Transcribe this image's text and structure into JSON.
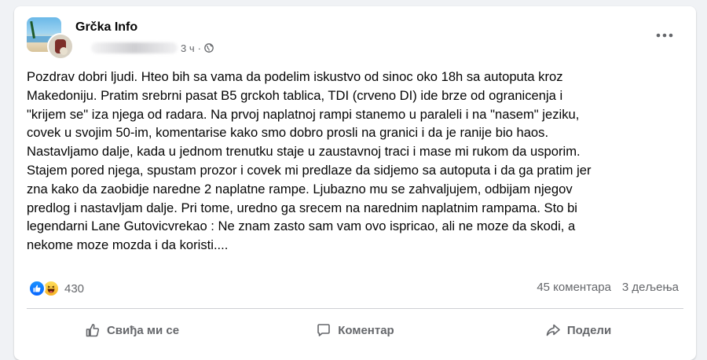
{
  "post": {
    "page_name": "Grčka Info",
    "time_label": "3 ч",
    "text": "Pozdrav dobri ljudi. Hteo bih sa vama da podelim iskustvo od sinoc oko 18h sa autoputa kroz\nMakedoniju. Pratim srebrni pasat B5 grckoh tablica, TDI (crveno DI) ide brze od ogranicenja i\n\"krijem se\" iza njega od radara. Na prvoj naplatnoj rampi stanemo u paraleli i na \"nasem\" jeziku,\ncovek u svojim 50-im, komentarise kako smo dobro prosli na granici i da je ranije bio haos.\nNastavljamo dalje, kada u jednom trenutku staje u zaustavnoj traci i mase mi rukom da usporim.\nStajem pored njega, spustam prozor i covek mi predlaze da sidjemo sa autoputa i da ga pratim jer\nzna kako da zaobidje naredne 2 naplatne rampe. Ljubazno mu se zahvaljujem, odbijam njegov\npredlog i nastavljam dalje. Pri tome, uredno ga srecem na narednim naplatnim rampama. Sto bi\nlegendarni Lane Gutovicvrekao : Ne znam zasto sam vam ovo ispricao, ali ne moze da skodi, a\nnekome moze mozda i da koristi...."
  },
  "reactions": {
    "count": "430",
    "icons": [
      "like-icon",
      "haha-icon"
    ]
  },
  "stats": {
    "comments": "45 коментара",
    "shares": "3 дељења"
  },
  "actions": {
    "like": "Свиђа ми се",
    "comment": "Коментар",
    "share": "Подели"
  },
  "colors": {
    "secondary_text": "#65676b",
    "like_blue": "#0866ff",
    "divider": "#ced0d4",
    "background": "#f0f2f5"
  }
}
